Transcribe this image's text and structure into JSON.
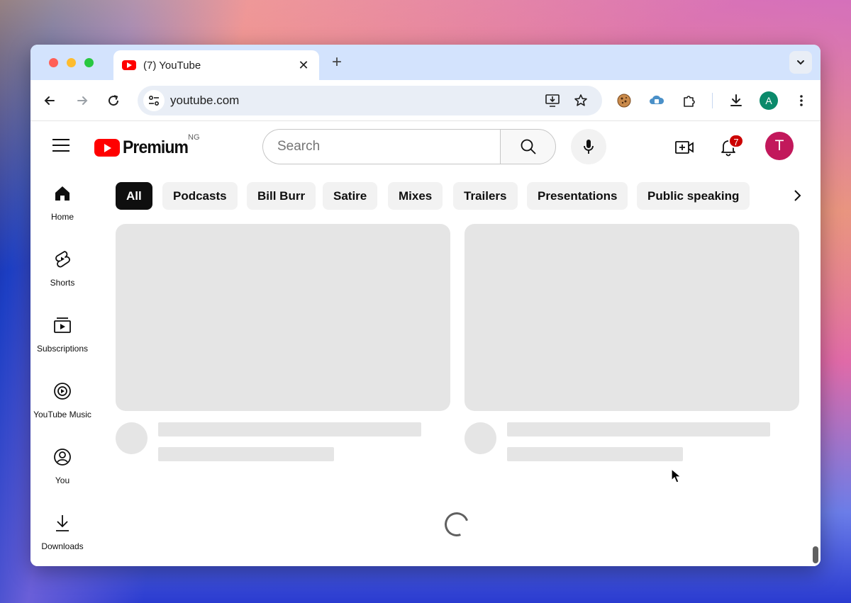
{
  "browser": {
    "tab": {
      "title": "(7) YouTube",
      "close_glyph": "✕"
    },
    "new_tab_glyph": "+",
    "url": "youtube.com",
    "profile_initial": "A"
  },
  "youtube": {
    "logo_text": "Premium",
    "country_code": "NG",
    "search": {
      "placeholder": "Search"
    },
    "notifications": {
      "count": "7"
    },
    "avatar_initial": "T",
    "sidebar": [
      {
        "label": "Home",
        "icon": "home-icon"
      },
      {
        "label": "Shorts",
        "icon": "shorts-icon"
      },
      {
        "label": "Subscriptions",
        "icon": "subscriptions-icon"
      },
      {
        "label": "YouTube Music",
        "icon": "youtube-music-icon"
      },
      {
        "label": "You",
        "icon": "you-icon"
      },
      {
        "label": "Downloads",
        "icon": "downloads-icon"
      }
    ],
    "chips": [
      {
        "label": "All",
        "active": true
      },
      {
        "label": "Podcasts"
      },
      {
        "label": "Bill Burr"
      },
      {
        "label": "Satire"
      },
      {
        "label": "Mixes"
      },
      {
        "label": "Trailers"
      },
      {
        "label": "Presentations"
      },
      {
        "label": "Public speaking"
      }
    ]
  },
  "colors": {
    "brand_red": "#ff0000",
    "badge_red": "#cc0000",
    "avatar_t": "#c2185b",
    "profile_a": "#0b8a6b",
    "skeleton": "#e5e5e5"
  }
}
